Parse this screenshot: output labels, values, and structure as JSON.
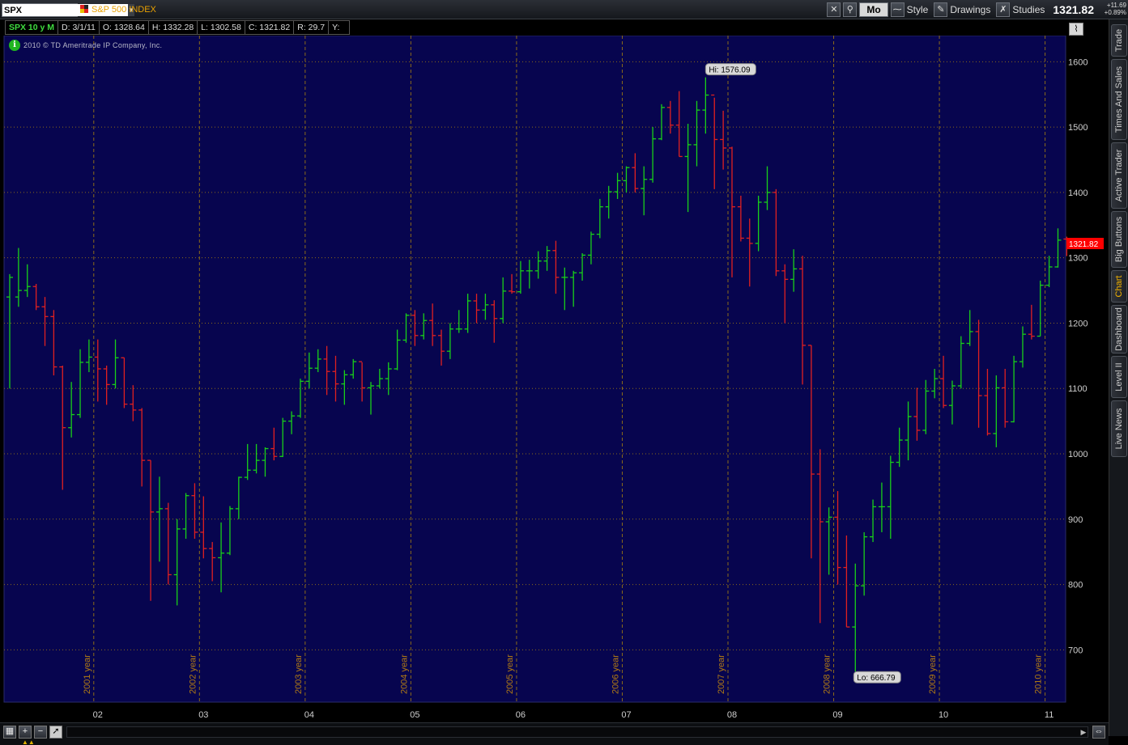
{
  "toolbar": {
    "symbol": "SPX",
    "index_name": "S&P 500 INDEX",
    "timeframe_button": "Mo",
    "style_label": "Style",
    "drawings_label": "Drawings",
    "studies_label": "Studies",
    "last_price": "1321.82",
    "net_change": "+11.69",
    "pct_change": "+0.89%"
  },
  "quote": {
    "symbol_period": "SPX 10 y M",
    "date": "D: 3/1/11",
    "open": "O: 1328.64",
    "high": "H: 1332.28",
    "low": "L: 1302.58",
    "close": "C: 1321.82",
    "range": "R: 29.7",
    "y": "Y:"
  },
  "copyright": "2010 © TD Ameritrade IP Company, Inc.",
  "side_tabs": [
    "Trade",
    "Times And Sales",
    "Active Trader",
    "Big Buttons",
    "Chart",
    "Dashboard",
    "Level II",
    "Live News"
  ],
  "active_tab": "Chart",
  "colors": {
    "background": "#07054f",
    "up": "#19d019",
    "down": "#e02020",
    "grid": "#8a6a1a",
    "price_tag": "#ff0000",
    "accent": "#e8a000"
  },
  "chart_data": {
    "type": "ohlc",
    "title": "SPX 10 y M",
    "ylim": [
      620,
      1640
    ],
    "y_ticks": [
      700,
      800,
      900,
      1000,
      1100,
      1200,
      1300,
      1400,
      1500,
      1600
    ],
    "x_tick_labels": [
      "02",
      "03",
      "04",
      "05",
      "06",
      "07",
      "08",
      "09",
      "10",
      "11"
    ],
    "year_labels": [
      "2001 year",
      "2002 year",
      "2003 year",
      "2004 year",
      "2005 year",
      "2006 year",
      "2007 year",
      "2008 year",
      "2009 year",
      "2010 year"
    ],
    "grid": true,
    "annotations": {
      "high": "Hi: 1576.09",
      "low": "Lo: 666.79"
    },
    "current_price_label": "1321.82",
    "bars": [
      {
        "date": "2001-03",
        "o": 1240,
        "h": 1275,
        "l": 1100,
        "c": 1270
      },
      {
        "date": "2001-04",
        "o": 1240,
        "h": 1315,
        "l": 1225,
        "c": 1250
      },
      {
        "date": "2001-05",
        "o": 1250,
        "h": 1290,
        "l": 1240,
        "c": 1256
      },
      {
        "date": "2001-06",
        "o": 1256,
        "h": 1260,
        "l": 1220,
        "c": 1225
      },
      {
        "date": "2001-07",
        "o": 1225,
        "h": 1240,
        "l": 1165,
        "c": 1210
      },
      {
        "date": "2001-08",
        "o": 1210,
        "h": 1220,
        "l": 1120,
        "c": 1133
      },
      {
        "date": "2001-09",
        "o": 1133,
        "h": 1135,
        "l": 945,
        "c": 1040
      },
      {
        "date": "2001-10",
        "o": 1040,
        "h": 1110,
        "l": 1025,
        "c": 1060
      },
      {
        "date": "2001-11",
        "o": 1060,
        "h": 1160,
        "l": 1055,
        "c": 1140
      },
      {
        "date": "2001-12",
        "o": 1140,
        "h": 1175,
        "l": 1125,
        "c": 1148
      },
      {
        "date": "2002-01",
        "o": 1148,
        "h": 1175,
        "l": 1080,
        "c": 1130
      },
      {
        "date": "2002-02",
        "o": 1130,
        "h": 1135,
        "l": 1075,
        "c": 1106
      },
      {
        "date": "2002-03",
        "o": 1106,
        "h": 1175,
        "l": 1100,
        "c": 1147
      },
      {
        "date": "2002-04",
        "o": 1147,
        "h": 1147,
        "l": 1070,
        "c": 1076
      },
      {
        "date": "2002-05",
        "o": 1076,
        "h": 1105,
        "l": 1050,
        "c": 1067
      },
      {
        "date": "2002-06",
        "o": 1067,
        "h": 1070,
        "l": 950,
        "c": 990
      },
      {
        "date": "2002-07",
        "o": 990,
        "h": 990,
        "l": 775,
        "c": 911
      },
      {
        "date": "2002-08",
        "o": 911,
        "h": 965,
        "l": 835,
        "c": 916
      },
      {
        "date": "2002-09",
        "o": 916,
        "h": 925,
        "l": 800,
        "c": 815
      },
      {
        "date": "2002-10",
        "o": 815,
        "h": 900,
        "l": 768,
        "c": 885
      },
      {
        "date": "2002-11",
        "o": 885,
        "h": 940,
        "l": 870,
        "c": 936
      },
      {
        "date": "2002-12",
        "o": 936,
        "h": 955,
        "l": 870,
        "c": 880
      },
      {
        "date": "2003-01",
        "o": 880,
        "h": 935,
        "l": 840,
        "c": 855
      },
      {
        "date": "2003-02",
        "o": 855,
        "h": 865,
        "l": 805,
        "c": 841
      },
      {
        "date": "2003-03",
        "o": 841,
        "h": 895,
        "l": 788,
        "c": 848
      },
      {
        "date": "2003-04",
        "o": 848,
        "h": 920,
        "l": 845,
        "c": 916
      },
      {
        "date": "2003-05",
        "o": 916,
        "h": 965,
        "l": 900,
        "c": 964
      },
      {
        "date": "2003-06",
        "o": 964,
        "h": 1015,
        "l": 960,
        "c": 975
      },
      {
        "date": "2003-07",
        "o": 975,
        "h": 1015,
        "l": 970,
        "c": 990
      },
      {
        "date": "2003-08",
        "o": 990,
        "h": 1010,
        "l": 965,
        "c": 1008
      },
      {
        "date": "2003-09",
        "o": 1008,
        "h": 1040,
        "l": 990,
        "c": 996
      },
      {
        "date": "2003-10",
        "o": 996,
        "h": 1055,
        "l": 995,
        "c": 1050
      },
      {
        "date": "2003-11",
        "o": 1050,
        "h": 1065,
        "l": 1030,
        "c": 1058
      },
      {
        "date": "2003-12",
        "o": 1058,
        "h": 1115,
        "l": 1055,
        "c": 1111
      },
      {
        "date": "2004-01",
        "o": 1111,
        "h": 1155,
        "l": 1100,
        "c": 1131
      },
      {
        "date": "2004-02",
        "o": 1131,
        "h": 1160,
        "l": 1125,
        "c": 1145
      },
      {
        "date": "2004-03",
        "o": 1145,
        "h": 1165,
        "l": 1090,
        "c": 1126
      },
      {
        "date": "2004-04",
        "o": 1126,
        "h": 1150,
        "l": 1080,
        "c": 1107
      },
      {
        "date": "2004-05",
        "o": 1107,
        "h": 1128,
        "l": 1075,
        "c": 1121
      },
      {
        "date": "2004-06",
        "o": 1121,
        "h": 1145,
        "l": 1115,
        "c": 1141
      },
      {
        "date": "2004-07",
        "o": 1141,
        "h": 1140,
        "l": 1080,
        "c": 1101
      },
      {
        "date": "2004-08",
        "o": 1101,
        "h": 1110,
        "l": 1060,
        "c": 1104
      },
      {
        "date": "2004-09",
        "o": 1104,
        "h": 1130,
        "l": 1100,
        "c": 1115
      },
      {
        "date": "2004-10",
        "o": 1115,
        "h": 1140,
        "l": 1090,
        "c": 1130
      },
      {
        "date": "2004-11",
        "o": 1130,
        "h": 1190,
        "l": 1128,
        "c": 1174
      },
      {
        "date": "2004-12",
        "o": 1174,
        "h": 1215,
        "l": 1170,
        "c": 1212
      },
      {
        "date": "2005-01",
        "o": 1212,
        "h": 1220,
        "l": 1165,
        "c": 1181
      },
      {
        "date": "2005-02",
        "o": 1181,
        "h": 1215,
        "l": 1175,
        "c": 1204
      },
      {
        "date": "2005-03",
        "o": 1204,
        "h": 1230,
        "l": 1165,
        "c": 1181
      },
      {
        "date": "2005-04",
        "o": 1181,
        "h": 1190,
        "l": 1135,
        "c": 1157
      },
      {
        "date": "2005-05",
        "o": 1157,
        "h": 1200,
        "l": 1145,
        "c": 1191
      },
      {
        "date": "2005-06",
        "o": 1191,
        "h": 1220,
        "l": 1185,
        "c": 1191
      },
      {
        "date": "2005-07",
        "o": 1191,
        "h": 1245,
        "l": 1185,
        "c": 1234
      },
      {
        "date": "2005-08",
        "o": 1234,
        "h": 1245,
        "l": 1200,
        "c": 1220
      },
      {
        "date": "2005-09",
        "o": 1220,
        "h": 1245,
        "l": 1205,
        "c": 1228
      },
      {
        "date": "2005-10",
        "o": 1228,
        "h": 1235,
        "l": 1170,
        "c": 1207
      },
      {
        "date": "2005-11",
        "o": 1207,
        "h": 1270,
        "l": 1200,
        "c": 1249
      },
      {
        "date": "2005-12",
        "o": 1249,
        "h": 1275,
        "l": 1245,
        "c": 1248
      },
      {
        "date": "2006-01",
        "o": 1248,
        "h": 1295,
        "l": 1245,
        "c": 1280
      },
      {
        "date": "2006-02",
        "o": 1280,
        "h": 1297,
        "l": 1253,
        "c": 1280
      },
      {
        "date": "2006-03",
        "o": 1280,
        "h": 1310,
        "l": 1268,
        "c": 1295
      },
      {
        "date": "2006-04",
        "o": 1295,
        "h": 1318,
        "l": 1280,
        "c": 1311
      },
      {
        "date": "2006-05",
        "o": 1311,
        "h": 1326,
        "l": 1245,
        "c": 1270
      },
      {
        "date": "2006-06",
        "o": 1270,
        "h": 1285,
        "l": 1220,
        "c": 1270
      },
      {
        "date": "2006-07",
        "o": 1270,
        "h": 1280,
        "l": 1225,
        "c": 1277
      },
      {
        "date": "2006-08",
        "o": 1277,
        "h": 1307,
        "l": 1265,
        "c": 1304
      },
      {
        "date": "2006-09",
        "o": 1304,
        "h": 1340,
        "l": 1290,
        "c": 1336
      },
      {
        "date": "2006-10",
        "o": 1336,
        "h": 1390,
        "l": 1330,
        "c": 1378
      },
      {
        "date": "2006-11",
        "o": 1378,
        "h": 1410,
        "l": 1360,
        "c": 1401
      },
      {
        "date": "2006-12",
        "o": 1401,
        "h": 1430,
        "l": 1390,
        "c": 1418
      },
      {
        "date": "2007-01",
        "o": 1418,
        "h": 1440,
        "l": 1400,
        "c": 1438
      },
      {
        "date": "2007-02",
        "o": 1438,
        "h": 1460,
        "l": 1400,
        "c": 1406
      },
      {
        "date": "2007-03",
        "o": 1406,
        "h": 1440,
        "l": 1365,
        "c": 1420
      },
      {
        "date": "2007-04",
        "o": 1420,
        "h": 1500,
        "l": 1415,
        "c": 1482
      },
      {
        "date": "2007-05",
        "o": 1482,
        "h": 1535,
        "l": 1480,
        "c": 1530
      },
      {
        "date": "2007-06",
        "o": 1530,
        "h": 1540,
        "l": 1490,
        "c": 1503
      },
      {
        "date": "2007-07",
        "o": 1503,
        "h": 1555,
        "l": 1455,
        "c": 1455
      },
      {
        "date": "2007-08",
        "o": 1455,
        "h": 1505,
        "l": 1370,
        "c": 1473
      },
      {
        "date": "2007-09",
        "o": 1473,
        "h": 1540,
        "l": 1440,
        "c": 1526
      },
      {
        "date": "2007-10",
        "o": 1526,
        "h": 1576.09,
        "l": 1490,
        "c": 1549
      },
      {
        "date": "2007-11",
        "o": 1549,
        "h": 1545,
        "l": 1405,
        "c": 1481
      },
      {
        "date": "2007-12",
        "o": 1481,
        "h": 1525,
        "l": 1435,
        "c": 1468
      },
      {
        "date": "2008-01",
        "o": 1468,
        "h": 1470,
        "l": 1270,
        "c": 1378
      },
      {
        "date": "2008-02",
        "o": 1378,
        "h": 1395,
        "l": 1325,
        "c": 1330
      },
      {
        "date": "2008-03",
        "o": 1330,
        "h": 1360,
        "l": 1256,
        "c": 1322
      },
      {
        "date": "2008-04",
        "o": 1322,
        "h": 1395,
        "l": 1310,
        "c": 1385
      },
      {
        "date": "2008-05",
        "o": 1385,
        "h": 1440,
        "l": 1373,
        "c": 1400
      },
      {
        "date": "2008-06",
        "o": 1400,
        "h": 1405,
        "l": 1272,
        "c": 1280
      },
      {
        "date": "2008-07",
        "o": 1280,
        "h": 1290,
        "l": 1200,
        "c": 1267
      },
      {
        "date": "2008-08",
        "o": 1267,
        "h": 1313,
        "l": 1248,
        "c": 1283
      },
      {
        "date": "2008-09",
        "o": 1283,
        "h": 1303,
        "l": 1106,
        "c": 1166
      },
      {
        "date": "2008-10",
        "o": 1166,
        "h": 1166,
        "l": 840,
        "c": 969
      },
      {
        "date": "2008-11",
        "o": 969,
        "h": 1007,
        "l": 741,
        "c": 896
      },
      {
        "date": "2008-12",
        "o": 896,
        "h": 918,
        "l": 815,
        "c": 903
      },
      {
        "date": "2009-01",
        "o": 903,
        "h": 943,
        "l": 800,
        "c": 826
      },
      {
        "date": "2009-02",
        "o": 826,
        "h": 875,
        "l": 735,
        "c": 735
      },
      {
        "date": "2009-03",
        "o": 735,
        "h": 832,
        "l": 666.79,
        "c": 798
      },
      {
        "date": "2009-04",
        "o": 798,
        "h": 880,
        "l": 783,
        "c": 873
      },
      {
        "date": "2009-05",
        "o": 873,
        "h": 930,
        "l": 865,
        "c": 919
      },
      {
        "date": "2009-06",
        "o": 919,
        "h": 956,
        "l": 880,
        "c": 919
      },
      {
        "date": "2009-07",
        "o": 919,
        "h": 997,
        "l": 870,
        "c": 987
      },
      {
        "date": "2009-08",
        "o": 987,
        "h": 1040,
        "l": 980,
        "c": 1021
      },
      {
        "date": "2009-09",
        "o": 1021,
        "h": 1080,
        "l": 990,
        "c": 1057
      },
      {
        "date": "2009-10",
        "o": 1057,
        "h": 1101,
        "l": 1020,
        "c": 1036
      },
      {
        "date": "2009-11",
        "o": 1036,
        "h": 1113,
        "l": 1030,
        "c": 1096
      },
      {
        "date": "2009-12",
        "o": 1096,
        "h": 1130,
        "l": 1085,
        "c": 1115
      },
      {
        "date": "2010-01",
        "o": 1115,
        "h": 1150,
        "l": 1070,
        "c": 1074
      },
      {
        "date": "2010-02",
        "o": 1074,
        "h": 1112,
        "l": 1045,
        "c": 1104
      },
      {
        "date": "2010-03",
        "o": 1104,
        "h": 1180,
        "l": 1100,
        "c": 1169
      },
      {
        "date": "2010-04",
        "o": 1169,
        "h": 1220,
        "l": 1165,
        "c": 1187
      },
      {
        "date": "2010-05",
        "o": 1187,
        "h": 1205,
        "l": 1040,
        "c": 1089
      },
      {
        "date": "2010-06",
        "o": 1089,
        "h": 1130,
        "l": 1028,
        "c": 1031
      },
      {
        "date": "2010-07",
        "o": 1031,
        "h": 1120,
        "l": 1010,
        "c": 1101
      },
      {
        "date": "2010-08",
        "o": 1101,
        "h": 1130,
        "l": 1040,
        "c": 1049
      },
      {
        "date": "2010-09",
        "o": 1049,
        "h": 1150,
        "l": 1048,
        "c": 1141
      },
      {
        "date": "2010-10",
        "o": 1141,
        "h": 1195,
        "l": 1132,
        "c": 1183
      },
      {
        "date": "2010-11",
        "o": 1183,
        "h": 1228,
        "l": 1175,
        "c": 1180
      },
      {
        "date": "2010-12",
        "o": 1180,
        "h": 1265,
        "l": 1180,
        "c": 1258
      },
      {
        "date": "2011-01",
        "o": 1258,
        "h": 1303,
        "l": 1255,
        "c": 1286
      },
      {
        "date": "2011-02",
        "o": 1286,
        "h": 1345,
        "l": 1285,
        "c": 1327
      },
      {
        "date": "2011-03",
        "o": 1328.64,
        "h": 1332.28,
        "l": 1302.58,
        "c": 1321.82
      }
    ]
  }
}
